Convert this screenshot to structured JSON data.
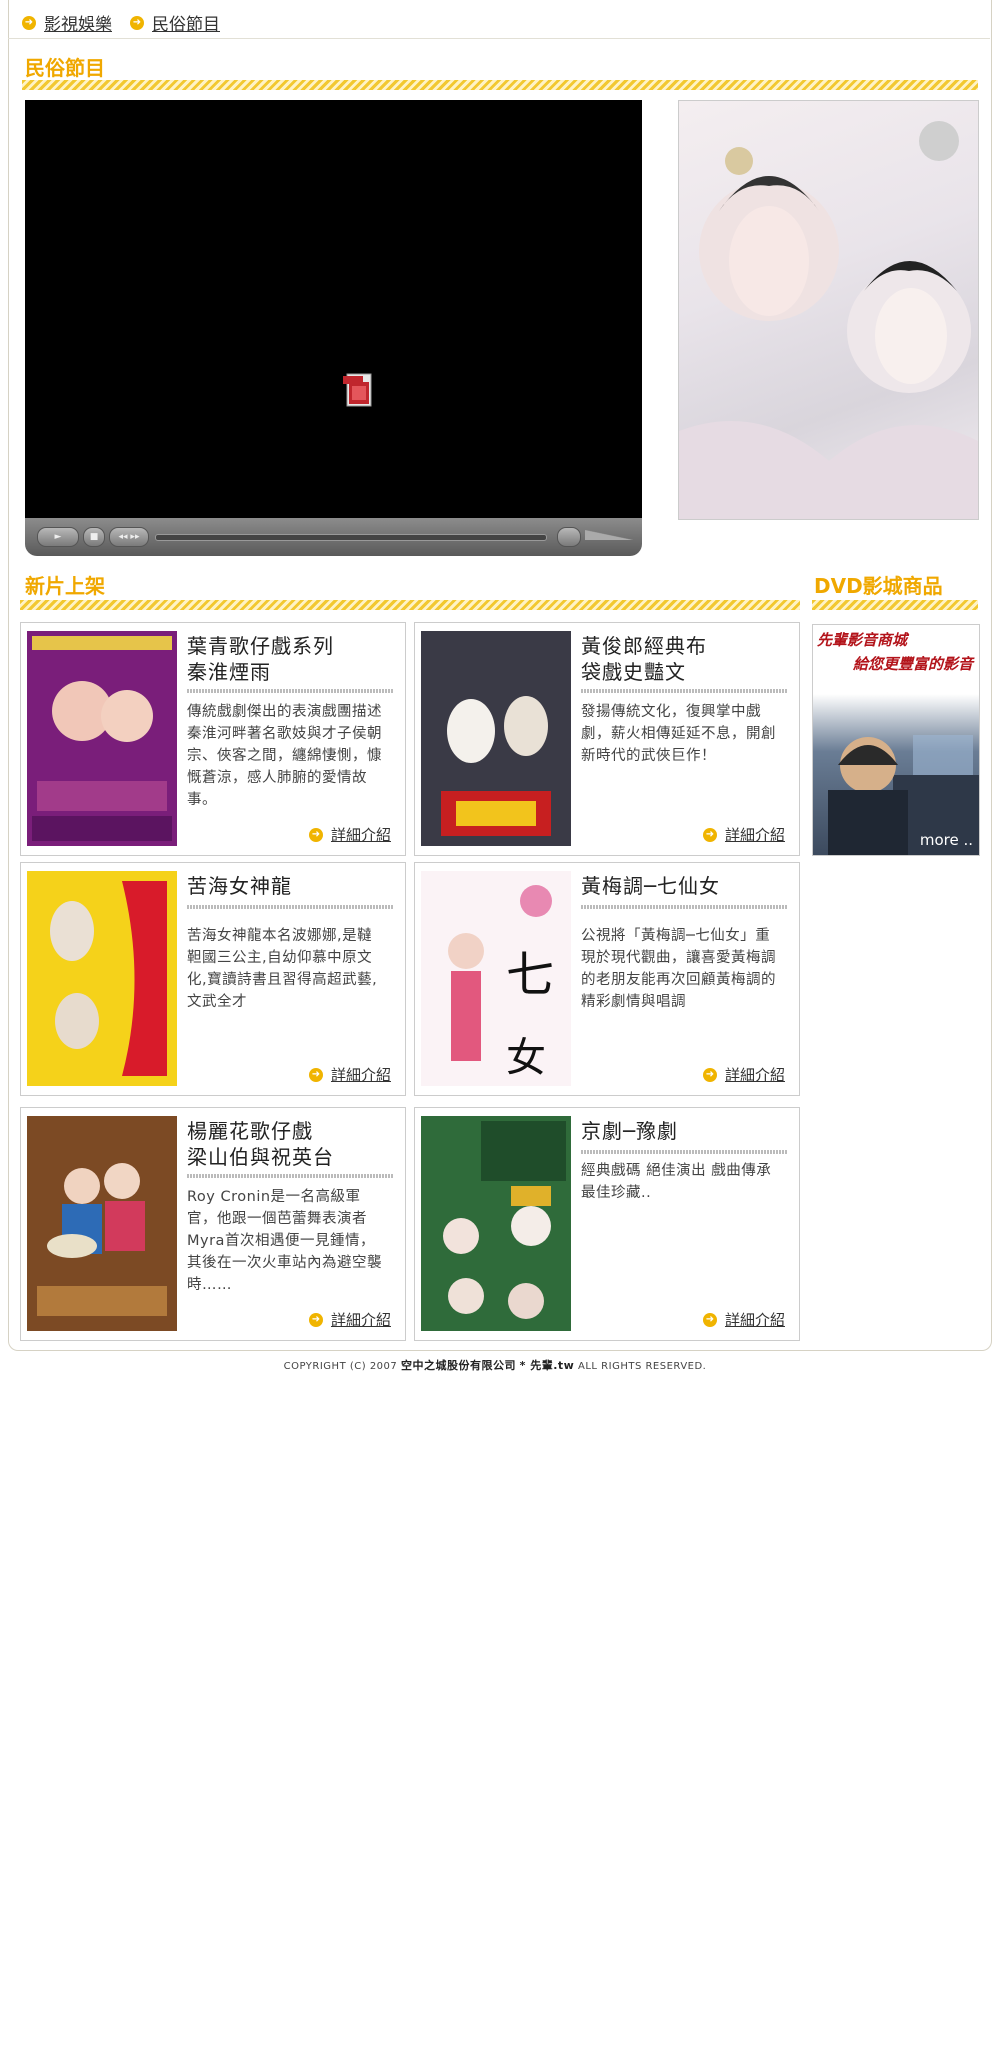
{
  "breadcrumb": {
    "item1": "影視娛樂",
    "item2": "民俗節目"
  },
  "section_title": "民俗節目",
  "player": {
    "icon": "flv-file-icon"
  },
  "new_releases": {
    "title": "新片上架",
    "more_label": "詳細介紹",
    "items": [
      {
        "title": "葉青歌仔戲系列\n秦淮煙雨",
        "desc": "傳統戲劇傑出的表演戲團描述秦淮河畔著名歌妓與才子侯朝宗、俠客之間，纏綿悽惻，慷慨蒼涼，感人肺腑的愛情故事。"
      },
      {
        "title": "黃俊郎經典布\n袋戲史豔文",
        "desc": "發揚傳統文化，復興掌中戲劇，薪火相傳延延不息，開創新時代的武俠巨作！"
      },
      {
        "title": "苦海女神龍",
        "desc": "苦海女神龍本名波娜娜,是韃靼國三公主,自幼仰慕中原文化,寶讀詩書且習得高超武藝,文武全才"
      },
      {
        "title": "黃梅調─七仙女",
        "desc": "公視將「黃梅調─七仙女」重現於現代觀曲，讓喜愛黃梅調的老朋友能再次回顧黃梅調的精彩劇情與唱調"
      },
      {
        "title": "楊麗花歌仔戲\n梁山伯與祝英台",
        "desc": "Roy Cronin是一名高級軍官，他跟一個芭蕾舞表演者Myra首次相遇便一見鍾情，其後在一次火車站內為避空襲時……"
      },
      {
        "title": "京劇─豫劇",
        "desc": "經典戲碼 絕佳演出 戲曲傳承 最佳珍藏.."
      }
    ]
  },
  "dvd": {
    "title": "DVD影城商品",
    "banner_line1": "先輩影音商城",
    "banner_line2": "給您更豐富的影音",
    "more": "more .."
  },
  "footer": {
    "prefix": "COPYRIGHT (C) 2007",
    "company": "空中之城股份有限公司",
    "brand": "* 先輩.tw",
    "suffix": "ALL RIGHTS RESERVED."
  },
  "colors": {
    "accent": "#f0a800",
    "stripe": "#f2c830",
    "banner_red": "#b3141b"
  }
}
